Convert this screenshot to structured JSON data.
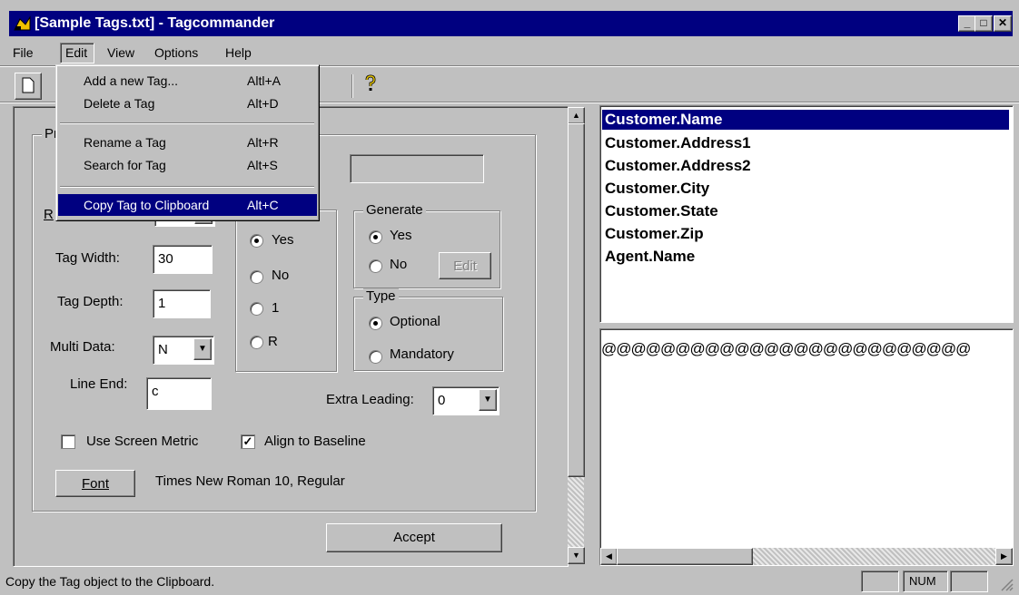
{
  "window": {
    "title": "[Sample Tags.txt] - Tagcommander"
  },
  "menubar": [
    "File",
    "Edit",
    "View",
    "Options",
    "Help"
  ],
  "edit_menu": {
    "items": [
      {
        "label": "Add a new Tag...",
        "accel": "Altl+A"
      },
      {
        "label": "Delete a Tag",
        "accel": "Alt+D"
      },
      {
        "label": "Rename a Tag",
        "accel": "Alt+R"
      },
      {
        "label": "Search for Tag",
        "accel": "Alt+S"
      },
      {
        "label": "Copy Tag to Clipboard",
        "accel": "Alt+C"
      }
    ],
    "highlighted_index": 4
  },
  "properties": {
    "group_title_fragment": "Pr",
    "obscured_label_fragment": "R",
    "tag_width": {
      "label": "Tag Width:",
      "value": "30"
    },
    "tag_depth": {
      "label": "Tag Depth:",
      "value": "1"
    },
    "multi_data": {
      "label": "Multi Data:",
      "value": "N"
    },
    "line_end": {
      "label": "Line End:",
      "value": "c"
    },
    "options_radios": [
      {
        "label": "Yes",
        "checked": true
      },
      {
        "label": "No",
        "checked": false
      },
      {
        "label": "1",
        "checked": false
      },
      {
        "label": "R",
        "checked": false
      }
    ],
    "generate": {
      "title": "Generate",
      "options": [
        {
          "label": "Yes",
          "checked": true
        },
        {
          "label": "No",
          "checked": false
        }
      ],
      "edit_button": "Edit"
    },
    "type": {
      "title": "Type",
      "options": [
        {
          "label": "Optional",
          "checked": true
        },
        {
          "label": "Mandatory",
          "checked": false
        }
      ]
    },
    "extra_leading": {
      "label": "Extra Leading:",
      "value": "0"
    },
    "use_screen_metric": {
      "label": "Use Screen Metric",
      "checked": false
    },
    "align_to_baseline": {
      "label": "Align to Baseline",
      "checked": true
    },
    "font_button": "Font",
    "font_desc": "Times New Roman 10, Regular",
    "accept_button": "Accept"
  },
  "tag_list": {
    "items": [
      "Customer.Name",
      "Customer.Address1",
      "Customer.Address2",
      "Customer.City",
      "Customer.State",
      "Customer.Zip",
      "Agent.Name"
    ],
    "selected_index": 0
  },
  "preview": {
    "text": "@@@@@@@@@@@@@@@@@@@@@@@@@"
  },
  "status": {
    "message": "Copy the Tag object to the Clipboard.",
    "num": "NUM"
  },
  "colors": {
    "titlebar": "#000080",
    "selection": "#000080",
    "face": "#c0c0c0"
  }
}
